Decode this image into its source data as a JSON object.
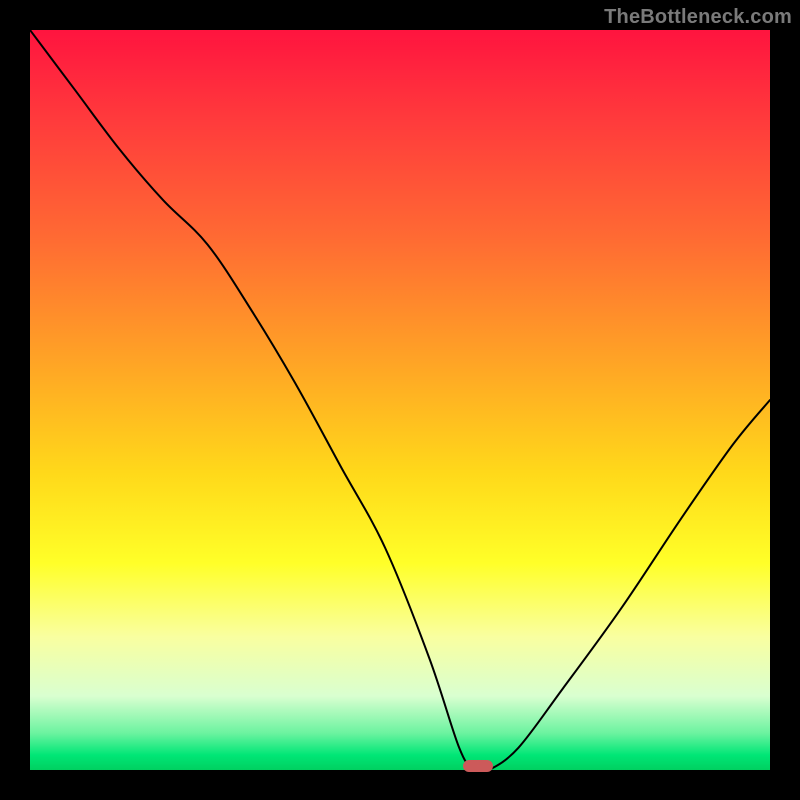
{
  "attribution": "TheBottleneck.com",
  "chart_data": {
    "type": "line",
    "title": "",
    "xlabel": "",
    "ylabel": "",
    "xlim": [
      0,
      1
    ],
    "ylim": [
      0,
      1
    ],
    "x": [
      0.0,
      0.06,
      0.12,
      0.18,
      0.24,
      0.3,
      0.36,
      0.42,
      0.48,
      0.54,
      0.58,
      0.6,
      0.62,
      0.66,
      0.72,
      0.8,
      0.88,
      0.95,
      1.0
    ],
    "values": [
      1.0,
      0.92,
      0.84,
      0.77,
      0.71,
      0.62,
      0.52,
      0.41,
      0.3,
      0.15,
      0.03,
      0.0,
      0.0,
      0.03,
      0.11,
      0.22,
      0.34,
      0.44,
      0.5
    ],
    "optimum_x": 0.605,
    "gradient_stops": [
      {
        "pos": 0.0,
        "color": "#ff143f"
      },
      {
        "pos": 0.28,
        "color": "#ff6a33"
      },
      {
        "pos": 0.6,
        "color": "#ffd91a"
      },
      {
        "pos": 0.82,
        "color": "#f9ffa0"
      },
      {
        "pos": 0.95,
        "color": "#6cf3a0"
      },
      {
        "pos": 1.0,
        "color": "#00d060"
      }
    ],
    "marker_color": "#cc5a5a"
  }
}
